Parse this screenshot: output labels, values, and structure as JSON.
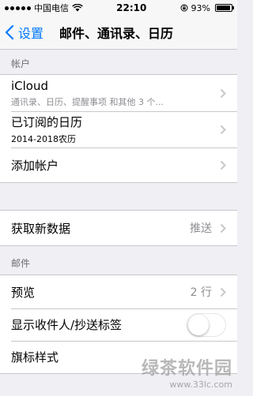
{
  "status_bar": {
    "carrier": "中国电信",
    "time": "22:10",
    "battery": "93%",
    "battery_level": 0.93,
    "icons": [
      "signal-icon",
      "wifi-icon",
      "orientation-lock-icon",
      "battery-icon"
    ]
  },
  "nav": {
    "back_label": "设置",
    "title": "邮件、通讯录、日历"
  },
  "accounts_section": {
    "header": "帐户",
    "items": [
      {
        "title": "iCloud",
        "subtitle": "通讯录、日历、提醒事项 和其他 3 个..."
      },
      {
        "title": "已订阅的日历",
        "subtitle": "2014-2018农历"
      },
      {
        "title": "添加帐户"
      }
    ]
  },
  "fetch_section": {
    "items": [
      {
        "title": "获取新数据",
        "value": "推送"
      }
    ]
  },
  "mail_section": {
    "header": "邮件",
    "items": [
      {
        "title": "预览",
        "value": "2 行"
      },
      {
        "title": "显示收件人/抄送标签",
        "toggle_on": false
      },
      {
        "title": "旗标样式"
      }
    ]
  },
  "watermark": {
    "main": "绿茶软件园",
    "sub": "www.33lc.com"
  },
  "colors": {
    "accent": "#007aff",
    "background": "#efeff4",
    "separator": "#c8c7cc",
    "secondary_text": "#8e8e93"
  }
}
